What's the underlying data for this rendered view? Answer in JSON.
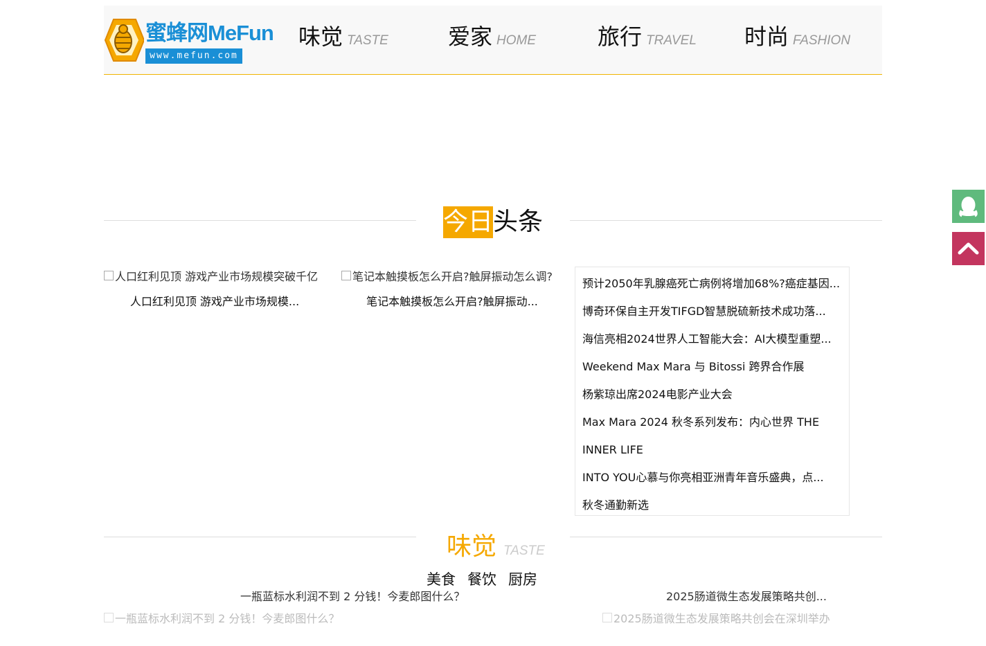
{
  "brand": {
    "name": "蜜蜂网MeFun",
    "url": "www.mefun.com",
    "colors": {
      "accent": "#f5a800",
      "logo_blue": "#1a8fd6",
      "qq_green": "#5fba7d",
      "top_red": "#c3355e"
    }
  },
  "nav": [
    {
      "cn": "味觉",
      "en": "TASTE"
    },
    {
      "cn": "爱家",
      "en": "HOME"
    },
    {
      "cn": "旅行",
      "en": "TRAVEL"
    },
    {
      "cn": "时尚",
      "en": "FASHION"
    }
  ],
  "headlines": {
    "title_highlight": "今日",
    "title_rest": "头条",
    "cards": [
      {
        "img_alt": "人口红利见顶 游戏产业市场规模突破千亿",
        "title": "人口红利见顶 游戏产业市场规模..."
      },
      {
        "img_alt": "笔记本触摸板怎么开启?触屏振动怎么调?",
        "title": "笔记本触摸板怎么开启?触屏振动..."
      }
    ],
    "list": [
      "预计2050年乳腺癌死亡病例将增加68%?癌症基因...",
      "博奇环保自主开发TIFGD智慧脱硫新技术成功落...",
      "海信亮相2024世界人工智能大会：AI大模型重塑...",
      "Weekend Max Mara 与 Bitossi 跨界合作展",
      "杨紫琼出席2024电影产业大会",
      "Max Mara 2024 秋冬系列发布：内心世界 THE",
      "INNER LIFE",
      "INTO YOU心慕与你亮相亚洲青年音乐盛典，点...",
      "秋冬通勤新选"
    ]
  },
  "taste": {
    "cn": "味觉",
    "en": "TASTE",
    "tabs": [
      "美食",
      "餐饮",
      "厨房"
    ],
    "left": {
      "title": "一瓶蓝标水利润不到 2 分钱！今麦郎图什么？",
      "img_alt": "一瓶蓝标水利润不到 2 分钱！今麦郎图什么？"
    },
    "right": {
      "title": "2025肠道微生态发展策略共创...",
      "img_alt": "2025肠道微生态发展策略共创会在深圳举办"
    }
  },
  "side": {
    "qq_icon": "qq-penguin-icon",
    "top_icon": "chevron-up-icon"
  }
}
